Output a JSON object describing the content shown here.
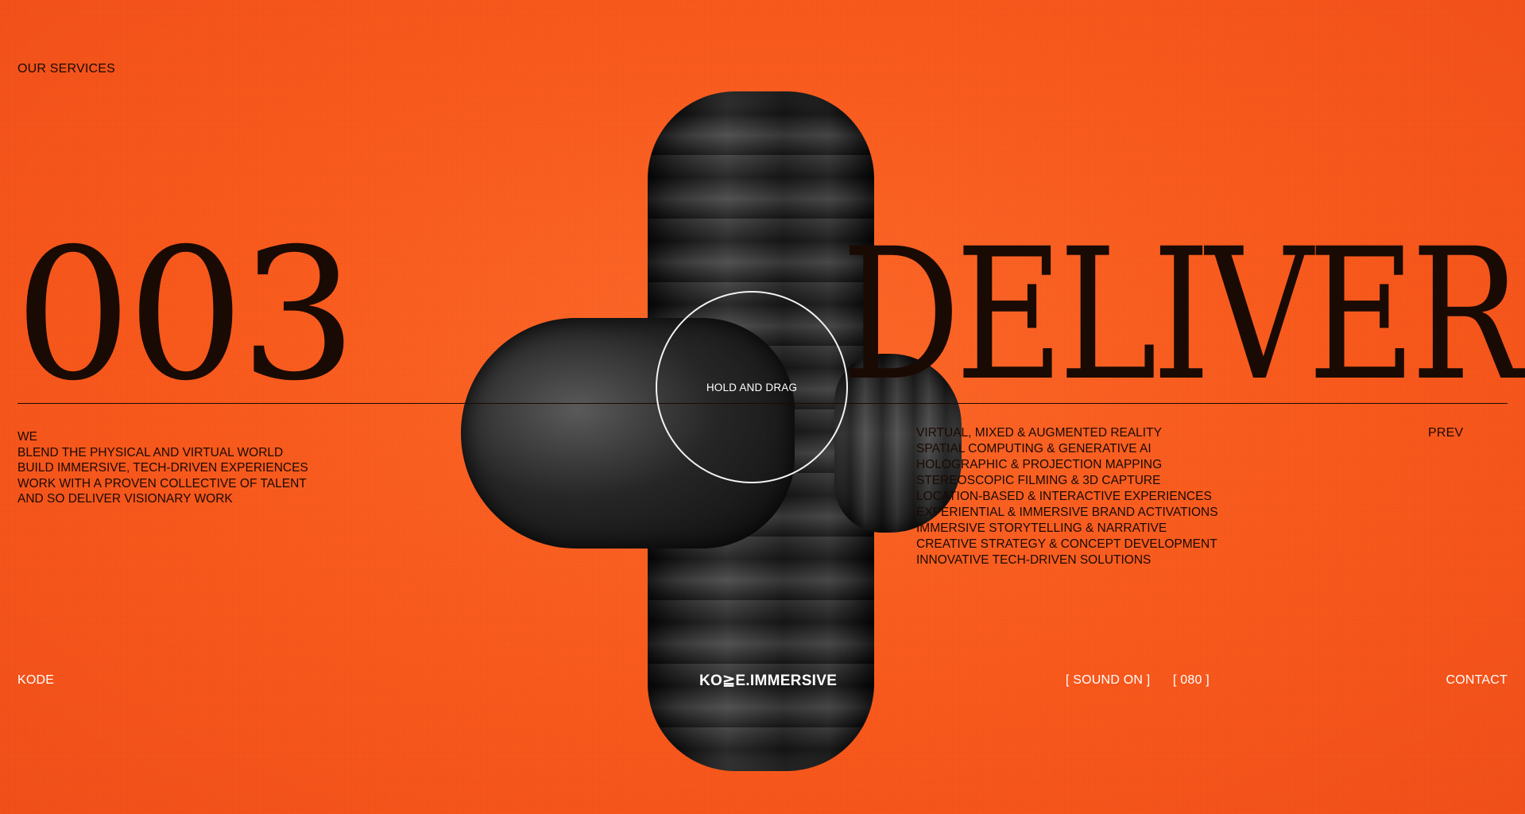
{
  "header": {
    "section_label": "OUR SERVICES"
  },
  "hero": {
    "number": "003",
    "word": "DELIVER"
  },
  "statement": {
    "lines": [
      "WE",
      "BLEND THE PHYSICAL AND VIRTUAL WORLD",
      "BUILD IMMERSIVE, TECH-DRIVEN EXPERIENCES",
      "WORK WITH A PROVEN COLLECTIVE OF TALENT",
      "AND SO DELIVER VISIONARY WORK"
    ]
  },
  "services": {
    "items": [
      "VIRTUAL, MIXED & AUGMENTED REALITY",
      "SPATIAL COMPUTING & GENERATIVE AI",
      "HOLOGRAPHIC & PROJECTION MAPPING",
      "STEREOSCOPIC FILMING & 3D CAPTURE",
      "LOCATION-BASED & INTERACTIVE EXPERIENCES",
      "EXPERIENTIAL & IMMERSIVE BRAND ACTIVATIONS",
      "IMMERSIVE STORYTELLING & NARRATIVE",
      "CREATIVE STRATEGY & CONCEPT DEVELOPMENT",
      "INNOVATIVE TECH-DRIVEN SOLUTIONS"
    ]
  },
  "nav": {
    "prev": "PREV"
  },
  "interaction": {
    "hint": "HOLD AND DRAG"
  },
  "footer": {
    "left": "KODE",
    "logo": "KO≧E.IMMERSIVE",
    "sound": "[ SOUND ON ]",
    "counter": "[ 080 ]",
    "contact": "CONTACT"
  },
  "colors": {
    "background": "#fb5a1c",
    "text": "#1a0a04",
    "footer_text": "#ffffff",
    "object": "#1c1c1c"
  }
}
